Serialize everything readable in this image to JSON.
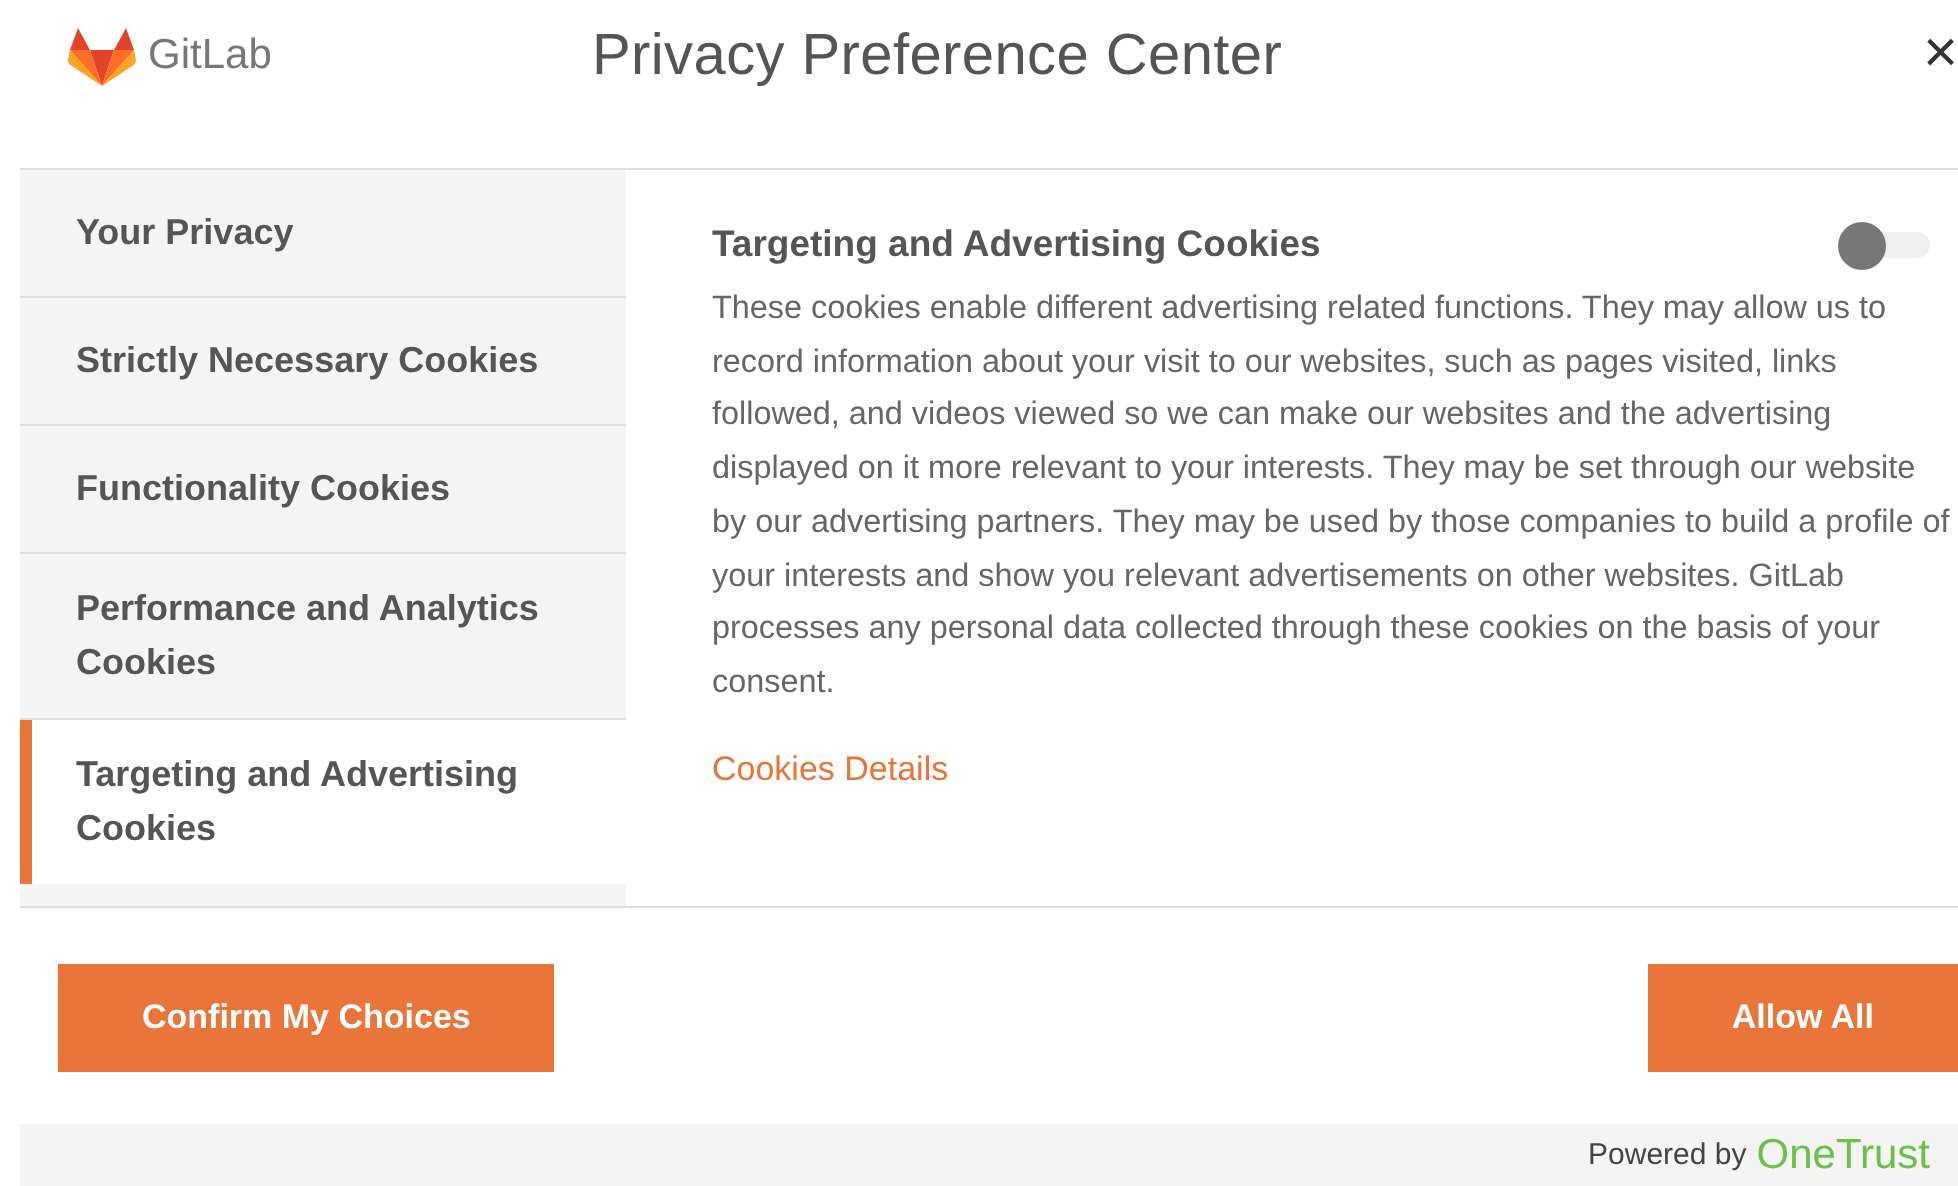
{
  "header": {
    "logo_text": "GitLab",
    "title": "Privacy Preference Center",
    "close": "×"
  },
  "sidebar": {
    "items": [
      {
        "label": "Your Privacy",
        "selected": false
      },
      {
        "label": "Strictly Necessary Cookies",
        "selected": false
      },
      {
        "label": "Functionality Cookies",
        "selected": false
      },
      {
        "label": "Performance and Analytics Cookies",
        "selected": false
      },
      {
        "label": "Targeting and Advertising Cookies",
        "selected": true
      }
    ]
  },
  "content": {
    "heading": "Targeting and Advertising Cookies",
    "toggle_on": false,
    "body": "These cookies enable different advertising related functions. They may allow us to record information about your visit to our websites, such as pages visited, links followed, and videos viewed so we can make our websites and the advertising displayed on it more relevant to your interests. They may be set through our website by our advertising partners. They may be used by those companies to build a profile of your interests and show you relevant advertisements on other websites. GitLab processes any personal data collected through these cookies on the basis of your consent.",
    "link": "Cookies Details"
  },
  "buttons": [
    "Confirm My Choices",
    "Allow All"
  ],
  "footer": {
    "powered_by": "Powered by",
    "brand": "OneTrust"
  }
}
